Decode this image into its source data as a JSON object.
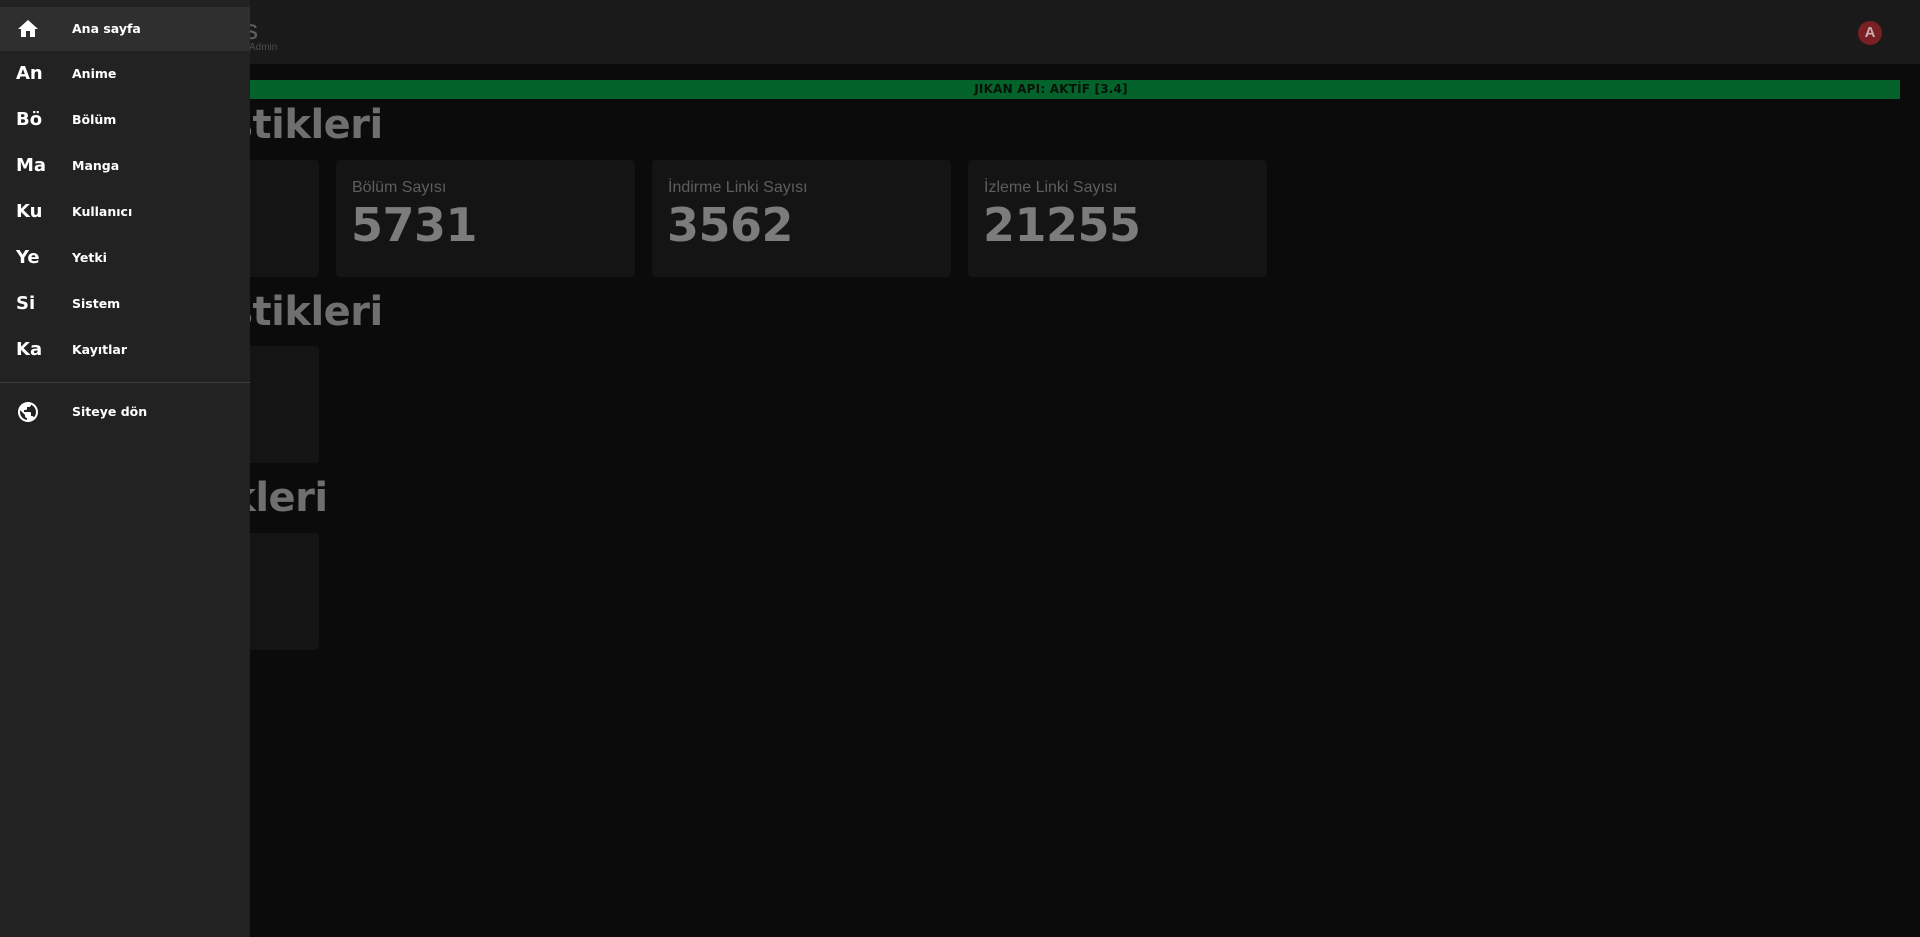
{
  "topbar": {
    "logo_text": "ubs",
    "logo_sub": "Admin",
    "avatar_letter": "A"
  },
  "api_banner": {
    "text": "JIKAN API: AKTİF [3.4]"
  },
  "sections": [
    {
      "title": "istikleri",
      "cards": [
        {
          "label": "",
          "value": ""
        },
        {
          "label": "Bölüm Sayısı",
          "value": "5731"
        },
        {
          "label": "İndirme Linki Sayısı",
          "value": "3562"
        },
        {
          "label": "İzleme Linki Sayısı",
          "value": "21255"
        }
      ]
    },
    {
      "title": "istikleri",
      "cards": [
        {
          "label": "",
          "value": ""
        }
      ]
    },
    {
      "title": "ikleri",
      "cards": [
        {
          "label": "",
          "value": ""
        }
      ]
    }
  ],
  "drawer": {
    "items": [
      {
        "abbr": "",
        "label": "Ana sayfa",
        "icon": "home-icon"
      },
      {
        "abbr": "An",
        "label": "Anime"
      },
      {
        "abbr": "Bö",
        "label": "Bölüm"
      },
      {
        "abbr": "Ma",
        "label": "Manga"
      },
      {
        "abbr": "Ku",
        "label": "Kullanıcı"
      },
      {
        "abbr": "Ye",
        "label": "Yetki"
      },
      {
        "abbr": "Si",
        "label": "Sistem"
      },
      {
        "abbr": "Ka",
        "label": "Kayıtlar"
      }
    ],
    "footer_item": {
      "label": "Siteye dön",
      "icon": "globe-icon"
    }
  },
  "colors": {
    "banner_green": "#03632a",
    "avatar_red": "#7a1f24",
    "drawer_bg": "#222222",
    "page_bg": "#0b0b0b"
  }
}
